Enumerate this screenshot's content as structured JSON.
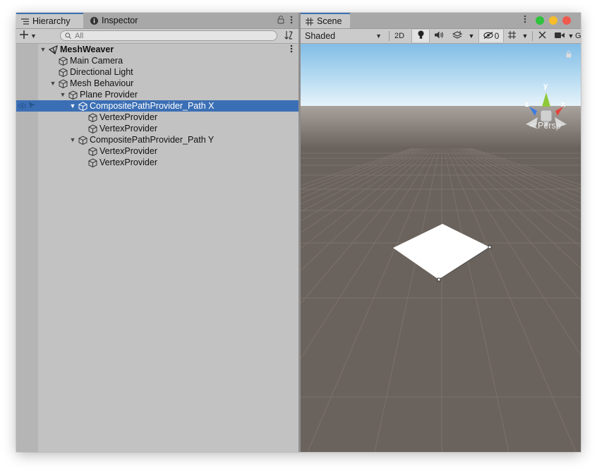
{
  "hierarchy_tab": {
    "label": "Hierarchy",
    "icon": "list-icon"
  },
  "inspector_tab": {
    "label": "Inspector",
    "icon": "info-icon"
  },
  "scene_tab": {
    "label": "Scene",
    "icon": "hash-icon"
  },
  "search": {
    "placeholder": "All"
  },
  "tree": [
    {
      "label": "MeshWeaver",
      "depth": 0,
      "expanded": true,
      "icon": "unity-scene-icon",
      "bold": true
    },
    {
      "label": "Main Camera",
      "depth": 1,
      "icon": "cube-icon"
    },
    {
      "label": "Directional Light",
      "depth": 1,
      "icon": "cube-icon"
    },
    {
      "label": "Mesh Behaviour",
      "depth": 1,
      "expanded": true,
      "icon": "cube-icon"
    },
    {
      "label": "Plane Provider",
      "depth": 2,
      "expanded": true,
      "icon": "cube-icon"
    },
    {
      "label": "CompositePathProvider_Path X",
      "depth": 3,
      "expanded": true,
      "icon": "cube-icon",
      "selected": true
    },
    {
      "label": "VertexProvider",
      "depth": 4,
      "icon": "cube-icon"
    },
    {
      "label": "VertexProvider",
      "depth": 4,
      "icon": "cube-icon"
    },
    {
      "label": "CompositePathProvider_Path Y",
      "depth": 3,
      "expanded": true,
      "icon": "cube-icon"
    },
    {
      "label": "VertexProvider",
      "depth": 4,
      "icon": "cube-icon"
    },
    {
      "label": "VertexProvider",
      "depth": 4,
      "icon": "cube-icon"
    }
  ],
  "scene_toolbar": {
    "shading_mode": "Shaded",
    "mode_2d": "2D",
    "hidden_count": "0",
    "overflow_label": "G"
  },
  "gizmo": {
    "y_label": "y",
    "x_label": "x",
    "z_label": "z",
    "projection": "Persp"
  },
  "colors": {
    "selection": "#3b6fb5",
    "scene_ground": "#6a625c",
    "sky": "#8fc4e8",
    "axis_x": "#e2453b",
    "axis_y": "#8fc93a",
    "axis_z": "#3b7be2",
    "plane": "#ffffff"
  }
}
